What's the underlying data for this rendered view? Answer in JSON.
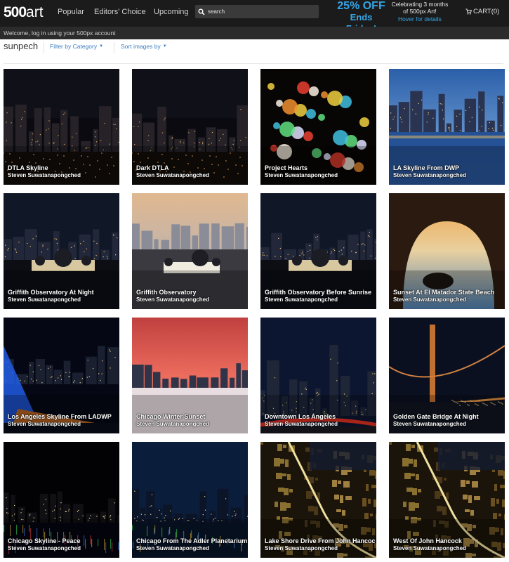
{
  "header": {
    "logo_main": "500",
    "logo_suffix": "art",
    "nav": [
      "Popular",
      "Editors' Choice",
      "Upcoming"
    ],
    "search_placeholder": "search",
    "promo": {
      "headline": "25% OFF",
      "subline": "Ends Friday!",
      "detail_line1": "Celebrating 3 months",
      "detail_line2": "of 500px Art!",
      "hover_text": "Hover for details"
    },
    "cart_label": "CART(0)"
  },
  "welcome_text": "Welcome, log in using your 500px account",
  "subheader": {
    "username": "sunpech",
    "filter_label": "Filter by Category",
    "sort_label": "Sort images by"
  },
  "photos": [
    {
      "title": "DTLA Skyline",
      "author": "Steven Suwatanapongched",
      "scene": "city-night"
    },
    {
      "title": "Dark DTLA",
      "author": "Steven Suwatanapongched",
      "scene": "city-night"
    },
    {
      "title": "Project Hearts",
      "author": "Steven Suwatanapongched",
      "scene": "bokeh"
    },
    {
      "title": "LA Skyline From DWP",
      "author": "Steven Suwatanapongched",
      "scene": "blue-skyline"
    },
    {
      "title": "Griffith Observatory At Night",
      "author": "Steven Suwatanapongched",
      "scene": "observatory-night"
    },
    {
      "title": "Griffith Observatory",
      "author": "Steven Suwatanapongched",
      "scene": "observatory-dusk"
    },
    {
      "title": "Griffith Observatory Before Sunrise",
      "author": "Steven Suwatanapongched",
      "scene": "observatory-night"
    },
    {
      "title": "Sunset At El Matador State Beach",
      "author": "Steven Suwatanapongched",
      "scene": "cave-sunset"
    },
    {
      "title": "Los Angeles Skyline From LADWP",
      "author": "Steven Suwatanapongched",
      "scene": "fountain"
    },
    {
      "title": "Chicago Winter Sunset",
      "author": "Steven Suwatanapongched",
      "scene": "red-sunset"
    },
    {
      "title": "Downtown Los Angeles",
      "author": "Steven Suwatanapongched",
      "scene": "downtown-trails"
    },
    {
      "title": "Golden Gate Bridge At Night",
      "author": "Steven Suwatanapongched",
      "scene": "bridge"
    },
    {
      "title": "Chicago Skyline - Peace",
      "author": "Steven Suwatanapongched",
      "scene": "chicago-night"
    },
    {
      "title": "Chicago From The Adler Planetarium",
      "author": "Steven Suwatanapongched",
      "scene": "chicago-blue"
    },
    {
      "title": "Lake Shore Drive From John Hancock",
      "author": "Steven Suwatanapongched",
      "scene": "aerial-gold"
    },
    {
      "title": "West Of John Hancock",
      "author": "Steven Suwatanapongched",
      "scene": "aerial-gold"
    }
  ],
  "colors": {
    "topbar": "#1b1b1b",
    "accent_blue": "#35a6e8",
    "link_blue": "#3b7fc4"
  }
}
